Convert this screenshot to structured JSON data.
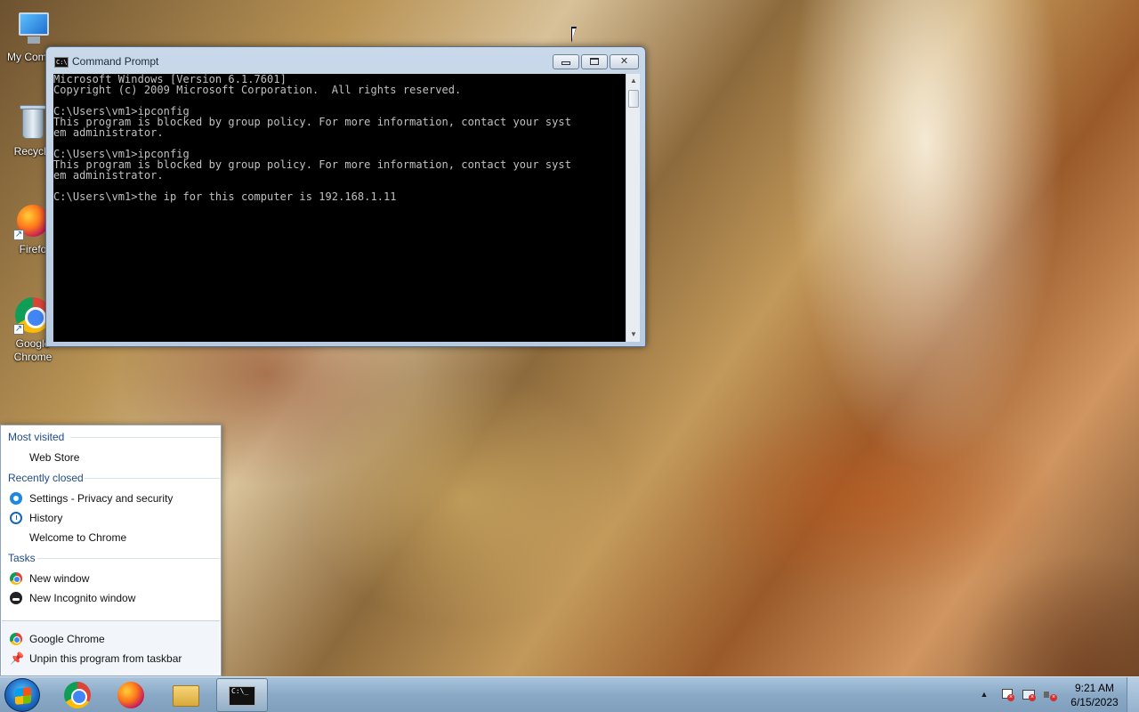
{
  "desktop": {
    "icons": [
      {
        "label": "My Compu",
        "icon": "computer-icon"
      },
      {
        "label": "Recycle",
        "icon": "recycle-bin-icon"
      },
      {
        "label": "Firefo",
        "icon": "firefox-icon"
      },
      {
        "label": "Google Chrome",
        "icon": "chrome-icon"
      }
    ]
  },
  "cmd_window": {
    "title": "Command Prompt",
    "icon_text": "C:\\",
    "buttons": {
      "minimize": "minimize",
      "maximize": "maximize",
      "close": "✕"
    },
    "lines": [
      "Microsoft Windows [Version 6.1.7601]",
      "Copyright (c) 2009 Microsoft Corporation.  All rights reserved.",
      "",
      "C:\\Users\\vm1>ipconfig",
      "This program is blocked by group policy. For more information, contact your syst",
      "em administrator.",
      "",
      "C:\\Users\\vm1>ipconfig",
      "This program is blocked by group policy. For more information, contact your syst",
      "em administrator.",
      "",
      "C:\\Users\\vm1>the ip for this computer is 192.168.1.11"
    ]
  },
  "jumplist": {
    "most_visited": {
      "header": "Most visited",
      "items": [
        "Web Store"
      ]
    },
    "recently_closed": {
      "header": "Recently closed",
      "items": [
        {
          "label": "Settings - Privacy and security",
          "icon": "gear-icon"
        },
        {
          "label": "History",
          "icon": "history-icon"
        },
        {
          "label": "Welcome to Chrome",
          "icon": ""
        }
      ]
    },
    "tasks": {
      "header": "Tasks",
      "items": [
        {
          "label": "New window",
          "icon": "chrome-icon"
        },
        {
          "label": "New Incognito window",
          "icon": "incognito-icon"
        }
      ]
    },
    "bottom": {
      "app": "Google Chrome",
      "unpin": "Unpin this program from taskbar"
    }
  },
  "taskbar": {
    "pinned": [
      "chrome-icon",
      "firefox-icon",
      "explorer-icon",
      "command-prompt-icon"
    ],
    "cmd_icon_text": "C:\\_",
    "tray_arrow": "▲",
    "clock": {
      "time": "9:21 AM",
      "date": "6/15/2023"
    }
  }
}
